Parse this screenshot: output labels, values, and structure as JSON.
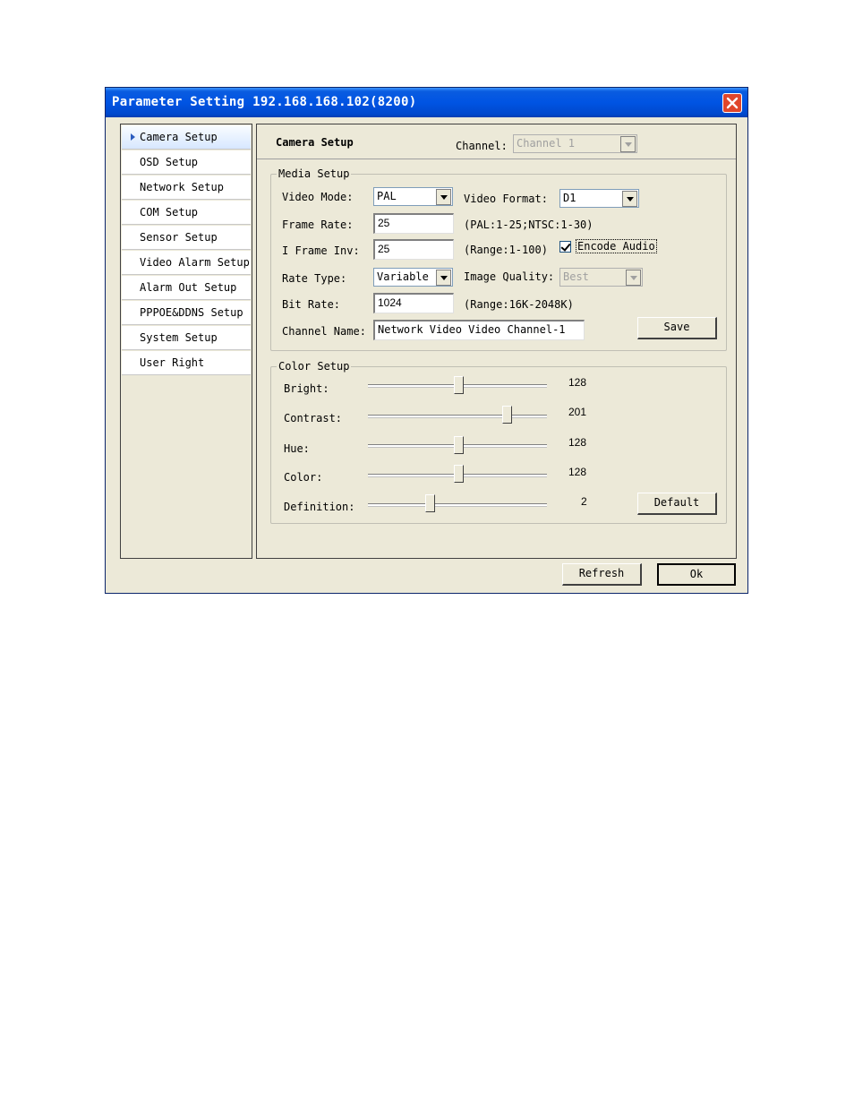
{
  "window": {
    "title": "Parameter Setting 192.168.168.102(8200)"
  },
  "sidebar": {
    "items": [
      {
        "label": "Camera Setup",
        "active": true
      },
      {
        "label": "OSD Setup"
      },
      {
        "label": "Network Setup"
      },
      {
        "label": "COM Setup"
      },
      {
        "label": "Sensor Setup"
      },
      {
        "label": "Video Alarm Setup"
      },
      {
        "label": "Alarm Out Setup"
      },
      {
        "label": "PPPOE&DDNS Setup"
      },
      {
        "label": "System Setup"
      },
      {
        "label": "User Right"
      }
    ]
  },
  "header": {
    "title": "Camera Setup",
    "channel_label": "Channel:",
    "channel_value": "Channel 1"
  },
  "media": {
    "legend": "Media Setup",
    "video_mode_label": "Video Mode:",
    "video_mode_value": "PAL",
    "video_format_label": "Video Format:",
    "video_format_value": "D1",
    "frame_rate_label": "Frame Rate:",
    "frame_rate_value": "25",
    "frame_rate_hint": "(PAL:1-25;NTSC:1-30)",
    "iframe_label": "I Frame Inv:",
    "iframe_value": "25",
    "iframe_hint": "(Range:1-100)",
    "encode_audio_label": "Encode Audio",
    "encode_audio_checked": true,
    "rate_type_label": "Rate Type:",
    "rate_type_value": "Variable",
    "image_quality_label": "Image Quality:",
    "image_quality_value": "Best",
    "bit_rate_label": "Bit Rate:",
    "bit_rate_value": "1024",
    "bit_rate_hint": "(Range:16K-2048K)",
    "channel_name_label": "Channel Name:",
    "channel_name_value": "Network Video Video Channel-1",
    "save_label": "Save"
  },
  "color": {
    "legend": "Color Setup",
    "sliders": [
      {
        "label": "Bright:",
        "value": "128",
        "fraction": 0.5
      },
      {
        "label": "Contrast:",
        "value": "201",
        "fraction": 0.78
      },
      {
        "label": "Hue:",
        "value": "128",
        "fraction": 0.5
      },
      {
        "label": "Color:",
        "value": "128",
        "fraction": 0.5
      },
      {
        "label": "Definition:",
        "value": "2",
        "fraction": 0.33
      }
    ],
    "default_label": "Default"
  },
  "footer": {
    "refresh_label": "Refresh",
    "ok_label": "Ok"
  },
  "colors": {
    "titlebar": "#0054e3",
    "close": "#e0462b",
    "dialog_bg": "#ece9d8"
  }
}
